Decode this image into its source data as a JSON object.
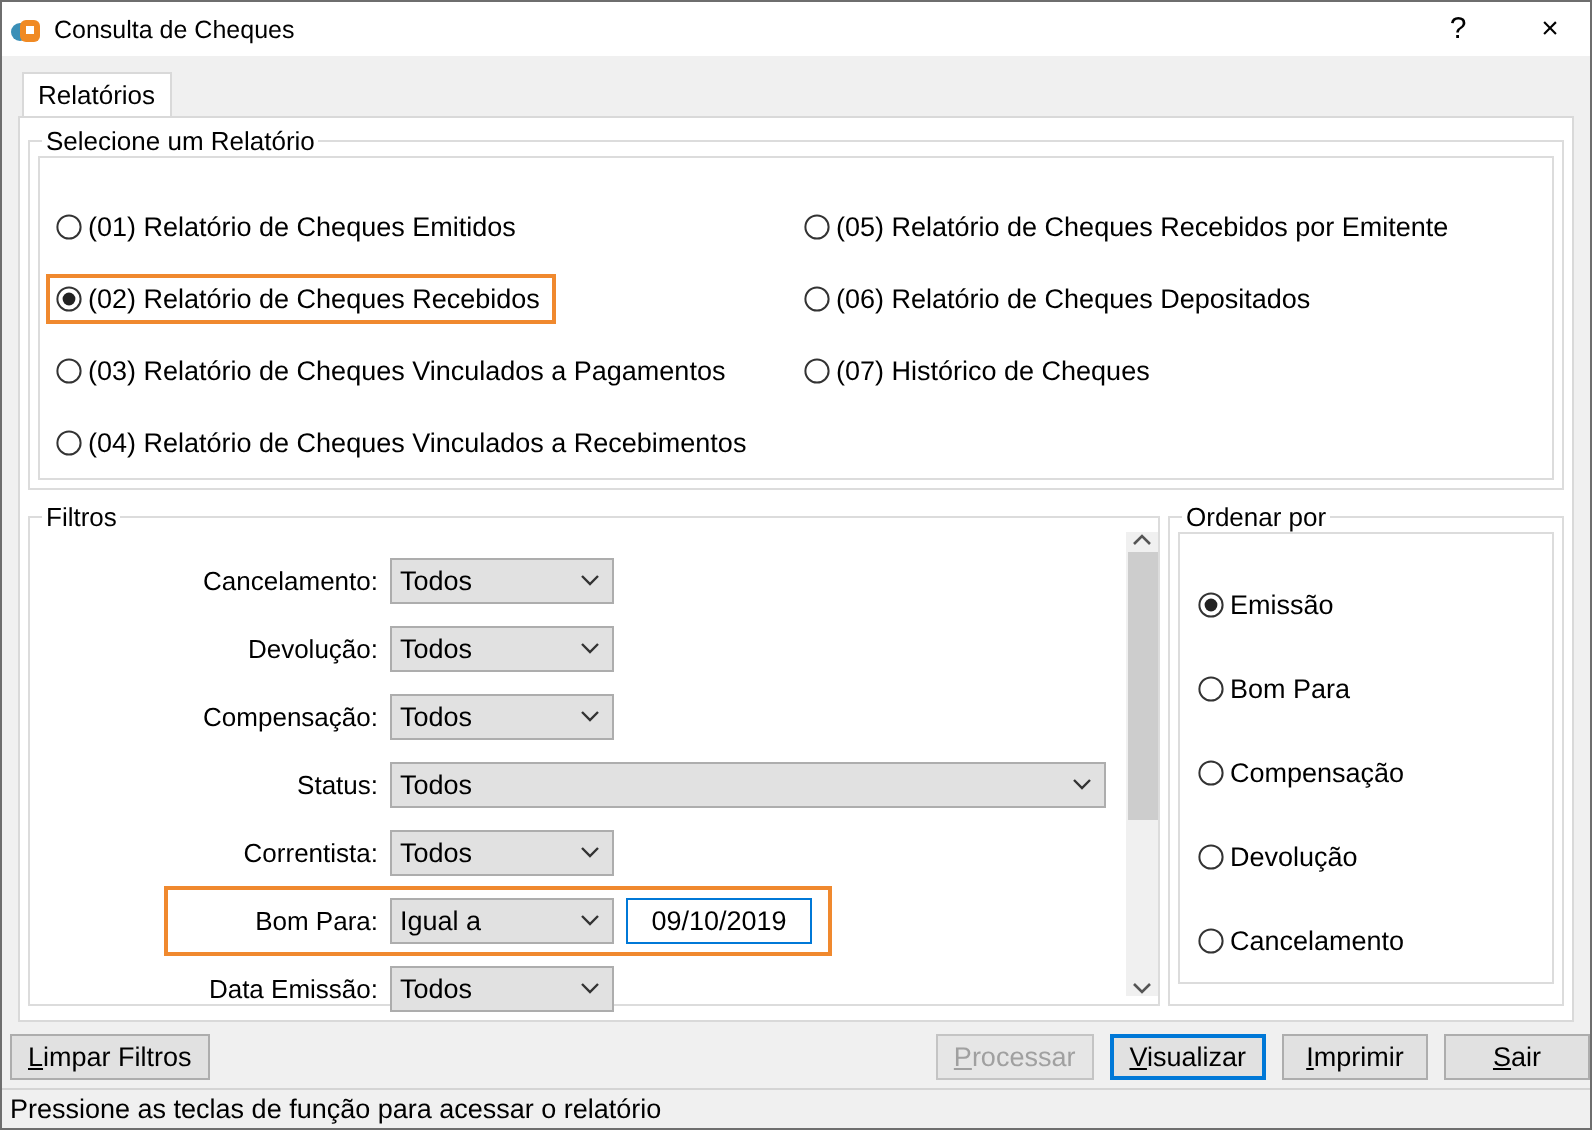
{
  "window": {
    "title": "Consulta de Cheques",
    "help": "?",
    "close": "×"
  },
  "tabs": [
    {
      "label": "Relatórios",
      "selected": true
    }
  ],
  "report_group": {
    "title": "Selecione um Relatório",
    "options": [
      {
        "label": "(01) Relatório de Cheques Emitidos",
        "selected": false,
        "highlighted": false
      },
      {
        "label": "(02) Relatório de Cheques Recebidos",
        "selected": true,
        "highlighted": true
      },
      {
        "label": "(03) Relatório de Cheques Vinculados a Pagamentos",
        "selected": false,
        "highlighted": false
      },
      {
        "label": "(04) Relatório de Cheques Vinculados a Recebimentos",
        "selected": false,
        "highlighted": false
      },
      {
        "label": "(05) Relatório de Cheques Recebidos por Emitente",
        "selected": false,
        "highlighted": false
      },
      {
        "label": "(06) Relatório de Cheques Depositados",
        "selected": false,
        "highlighted": false
      },
      {
        "label": "(07) Histórico de Cheques",
        "selected": false,
        "highlighted": false
      }
    ]
  },
  "filters": {
    "title": "Filtros",
    "rows": [
      {
        "kind": "combo",
        "label": "Cancelamento:",
        "value": "Todos",
        "highlighted": false
      },
      {
        "kind": "combo",
        "label": "Devolução:",
        "value": "Todos",
        "highlighted": false
      },
      {
        "kind": "combo",
        "label": "Compensação:",
        "value": "Todos",
        "highlighted": false
      },
      {
        "kind": "wide",
        "label": "Status:",
        "value": "Todos",
        "highlighted": false
      },
      {
        "kind": "combo",
        "label": "Correntista:",
        "value": "Todos",
        "highlighted": false
      },
      {
        "kind": "date",
        "label": "Bom Para:",
        "value": "Igual a",
        "date": "09/10/2019",
        "highlighted": true
      },
      {
        "kind": "combo",
        "label": "Data Emissão:",
        "value": "Todos",
        "highlighted": false
      }
    ]
  },
  "order_by": {
    "title": "Ordenar por",
    "options": [
      {
        "label": "Emissão",
        "selected": true
      },
      {
        "label": "Bom Para",
        "selected": false
      },
      {
        "label": "Compensação",
        "selected": false
      },
      {
        "label": "Devolução",
        "selected": false
      },
      {
        "label": "Cancelamento",
        "selected": false
      }
    ]
  },
  "left_buttons": [
    {
      "label": "Limpar Filtros",
      "disabled": false,
      "focused": false,
      "underline_first": true
    }
  ],
  "right_buttons": [
    {
      "label": "Processar",
      "disabled": true,
      "focused": false,
      "underline_first": true
    },
    {
      "label": "Visualizar",
      "disabled": false,
      "focused": true,
      "underline_first": true
    },
    {
      "label": "Imprimir",
      "disabled": false,
      "focused": false,
      "underline_first": true
    },
    {
      "label": "Sair",
      "disabled": false,
      "focused": false,
      "underline_first": true
    }
  ],
  "status_bar": "Pressione as teclas de função para acessar o relatório"
}
